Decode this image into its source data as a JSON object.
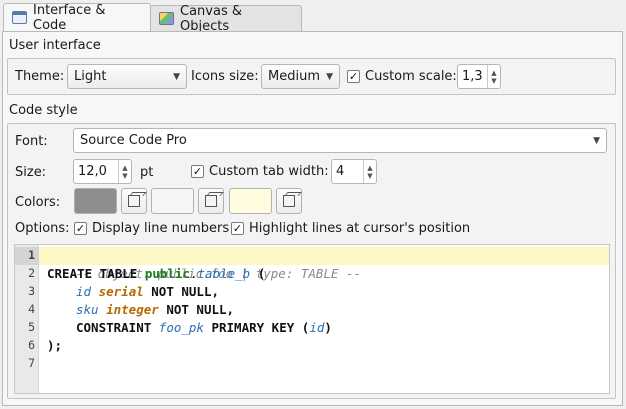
{
  "tabs": [
    {
      "label": "Interface & Code",
      "icon": "code-window-icon",
      "active": true
    },
    {
      "label": "Canvas & Objects",
      "icon": "canvas-icon",
      "active": false
    }
  ],
  "ui": {
    "section_title": "User interface",
    "theme_label": "Theme:",
    "theme_value": "Light",
    "icons_label": "Icons size:",
    "icons_value": "Medium",
    "custom_scale_label": "Custom scale:",
    "custom_scale_checked": true,
    "custom_scale_value": "1,3"
  },
  "code_style": {
    "section_title": "Code style",
    "font_label": "Font:",
    "font_value": "Source Code Pro",
    "size_label": "Size:",
    "size_value": "12,0",
    "size_unit": "pt",
    "tab_width_label": "Custom tab width:",
    "tab_width_checked": true,
    "tab_width_value": "4",
    "colors_label": "Colors:",
    "colors": [
      "#8e8e8e",
      "#f6f6f6",
      "#fffce0"
    ],
    "options_label": "Options:",
    "display_line_numbers_label": "Display line numbers",
    "display_line_numbers_checked": true,
    "highlight_lines_label": "Highlight lines at cursor's position",
    "highlight_lines_checked": true
  },
  "code_preview": {
    "line_numbers": [
      "1",
      "2",
      "3",
      "4",
      "5",
      "6",
      "7"
    ],
    "line1": "-- object: public.foo | type: TABLE --",
    "l2_create_table": "CREATE TABLE ",
    "l2_public": "public",
    "l2_dot": ".",
    "l2_table": "table_b",
    "l2_paren": " (",
    "l3_col": "id",
    "l3_type": "serial",
    "l3_rest": " NOT NULL,",
    "l4_col": "sku",
    "l4_type": "integer",
    "l4_rest": " NOT NULL,",
    "l5_constraint": "CONSTRAINT ",
    "l5_name": "foo_pk",
    "l5_pk": " PRIMARY KEY (",
    "l5_col": "id",
    "l5_close": ")",
    "l6": ");",
    "highlight_color": "#fbf8c6"
  }
}
